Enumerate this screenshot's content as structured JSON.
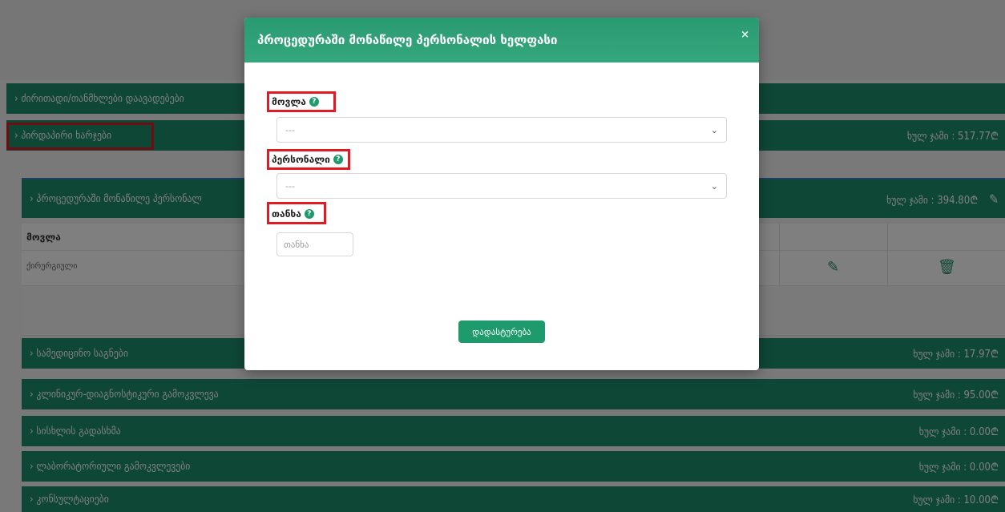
{
  "page": {
    "bars": {
      "main": "ძირითადი/თანმხლები დაავადებები",
      "costs_label": "პირდაპირი ხარჯები",
      "costs_total": "ხულ ჯამი : 517.77₾",
      "personnel_label": "პროცედურაში მონაწილე პერსონალ",
      "personnel_total": "ხულ ჯამი : 394.80₾",
      "sections": [
        {
          "label": "სამედიცინო საგნები",
          "total": "ხულ ჯამი : 17.97₾"
        },
        {
          "label": "კლინიკურ-დიაგნოსტიკური გამოკვლევა",
          "total": "ხულ ჯამი : 95.00₾"
        },
        {
          "label": "სისხლის გადასხმა",
          "total": "ხულ ჯამი : 0.00₾"
        },
        {
          "label": "ლაბორატორიული გამოკვლევები",
          "total": "ხულ ჯამი : 0.00₾"
        },
        {
          "label": "კონსულტაციები",
          "total": "ხულ ჯამი : 10.00₾"
        }
      ]
    },
    "table": {
      "header": "მოვლა",
      "row_value": "ქირურგიული"
    }
  },
  "modal": {
    "title": "პროცედურაში მონაწილე პერსონალის ხელფასი",
    "close": "×",
    "fields": {
      "care": {
        "label": "მოვლა",
        "value": "---"
      },
      "staff": {
        "label": "პერსონალი",
        "value": "---"
      },
      "amount": {
        "label": "თანხა",
        "placeholder": "თანხა"
      }
    },
    "help_glyph": "?",
    "submit": "დადასტურება"
  },
  "icons": [
    "chevron-down-icon",
    "help-icon",
    "edit-icon",
    "trash-icon",
    "close-icon"
  ],
  "colors": {
    "primary_green": "#1f8f6c",
    "highlight": "#e01b24"
  }
}
